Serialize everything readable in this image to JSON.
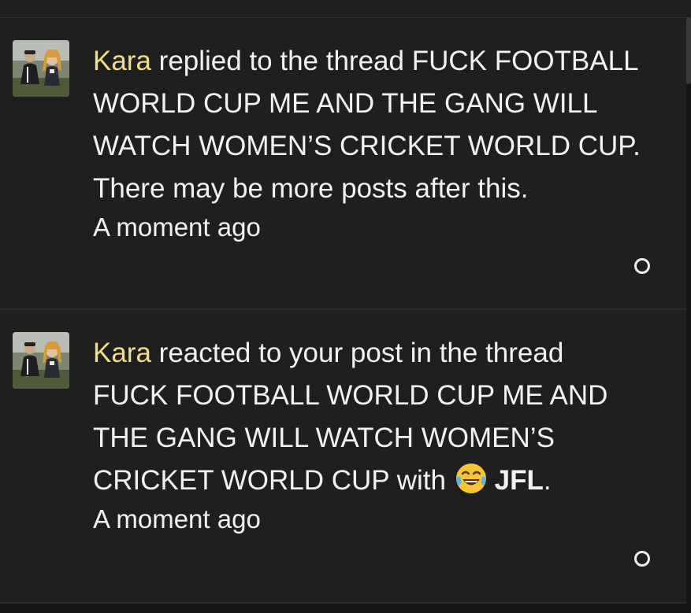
{
  "notifications": [
    {
      "username": "Kara",
      "action_text": " replied to the thread FUCK FOOTBALL WORLD CUP ME AND THE GANG WILL WATCH WOMEN’S CRICKET WORLD CUP. There may be more posts after this.",
      "time": "A moment ago",
      "avatar_icon": "user-avatar-photo",
      "toggle_icon": "circle-outline-icon"
    },
    {
      "username": "Kara",
      "action_text": " reacted to your post in the thread FUCK FOOTBALL WORLD CUP ME AND THE GANG WILL WATCH WOMEN’S CRICKET WORLD CUP with ",
      "reaction_emoji": "😂",
      "reaction_label": "JFL",
      "trailing": ".",
      "time": "A moment ago",
      "avatar_icon": "user-avatar-photo",
      "toggle_icon": "circle-outline-icon"
    }
  ],
  "colors": {
    "background": "#1f1f1f",
    "username": "#f3dd85",
    "text": "#f2f2f2"
  }
}
